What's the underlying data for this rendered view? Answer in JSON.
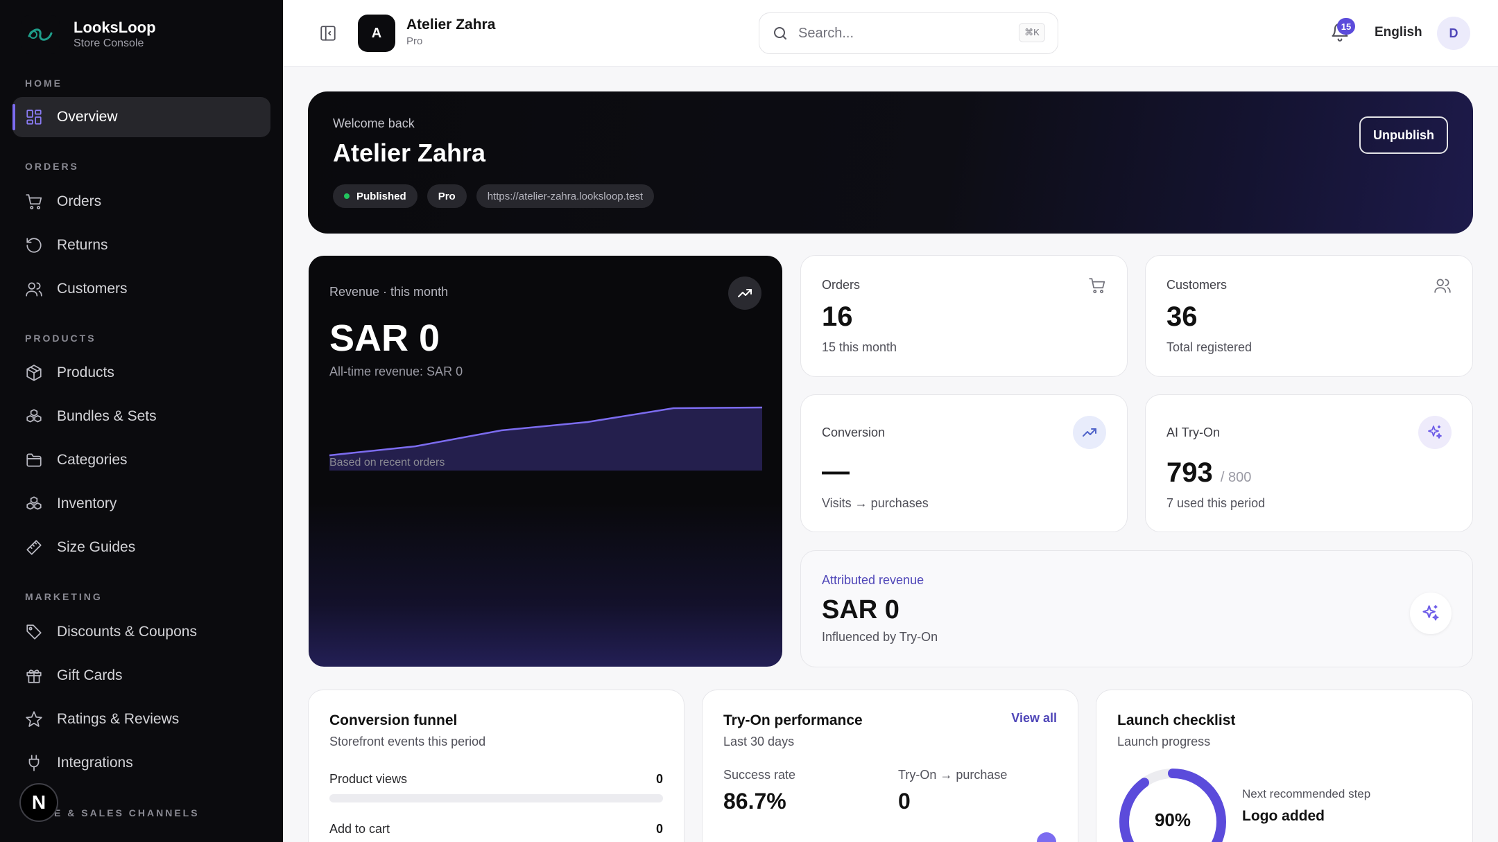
{
  "sidebar": {
    "brand_name": "LooksLoop",
    "brand_sub": "Store Console",
    "sections": {
      "home": "HOME",
      "orders": "ORDERS",
      "products": "PRODUCTS",
      "marketing": "MARKETING",
      "channels": "E & SALES CHANNELS"
    },
    "items": {
      "overview": "Overview",
      "orders": "Orders",
      "returns": "Returns",
      "customers": "Customers",
      "products": "Products",
      "bundles": "Bundles & Sets",
      "categories": "Categories",
      "inventory": "Inventory",
      "size_guides": "Size Guides",
      "discounts": "Discounts & Coupons",
      "gift_cards": "Gift Cards",
      "ratings": "Ratings & Reviews",
      "integrations": "Integrations"
    },
    "badge": "N"
  },
  "topbar": {
    "store_initial": "A",
    "store_name": "Atelier Zahra",
    "store_plan": "Pro",
    "search_placeholder": "Search...",
    "search_shortcut": "⌘K",
    "notification_count": "15",
    "language": "English",
    "user_initial": "D"
  },
  "hero": {
    "welcome": "Welcome back",
    "title": "Atelier Zahra",
    "status": "Published",
    "plan": "Pro",
    "url": "https://atelier-zahra.looksloop.test",
    "unpublish": "Unpublish"
  },
  "revenue": {
    "label": "Revenue · this month",
    "value": "SAR 0",
    "sub": "All-time revenue: SAR 0",
    "note": "Based on recent orders",
    "accent": "#7c6cf0"
  },
  "stats": {
    "orders": {
      "label": "Orders",
      "value": "16",
      "sub": "15 this month"
    },
    "customers": {
      "label": "Customers",
      "value": "36",
      "sub": "Total registered"
    },
    "conversion": {
      "label": "Conversion",
      "value": "—",
      "sub": "Visits → purchases"
    },
    "tryon": {
      "label": "AI Try-On",
      "value": "793",
      "limit": "/ 800",
      "sub": "7 used this period"
    },
    "attributed": {
      "label": "Attributed revenue",
      "value": "SAR 0",
      "sub": "Influenced by Try-On"
    }
  },
  "funnel": {
    "title": "Conversion funnel",
    "sub": "Storefront events this period",
    "rows": [
      {
        "label": "Product views",
        "value": "0"
      },
      {
        "label": "Add to cart",
        "value": "0"
      }
    ]
  },
  "tryon_perf": {
    "title": "Try-On performance",
    "sub": "Last 30 days",
    "view_all": "View all",
    "success_label": "Success rate",
    "success_value": "86.7%",
    "purchase_label": "Try-On → purchase",
    "purchase_value": "0"
  },
  "checklist": {
    "title": "Launch checklist",
    "sub": "Launch progress",
    "progress_text": "90%",
    "progress": 0.9,
    "next_label": "Next recommended step",
    "next_value": "Logo added"
  }
}
